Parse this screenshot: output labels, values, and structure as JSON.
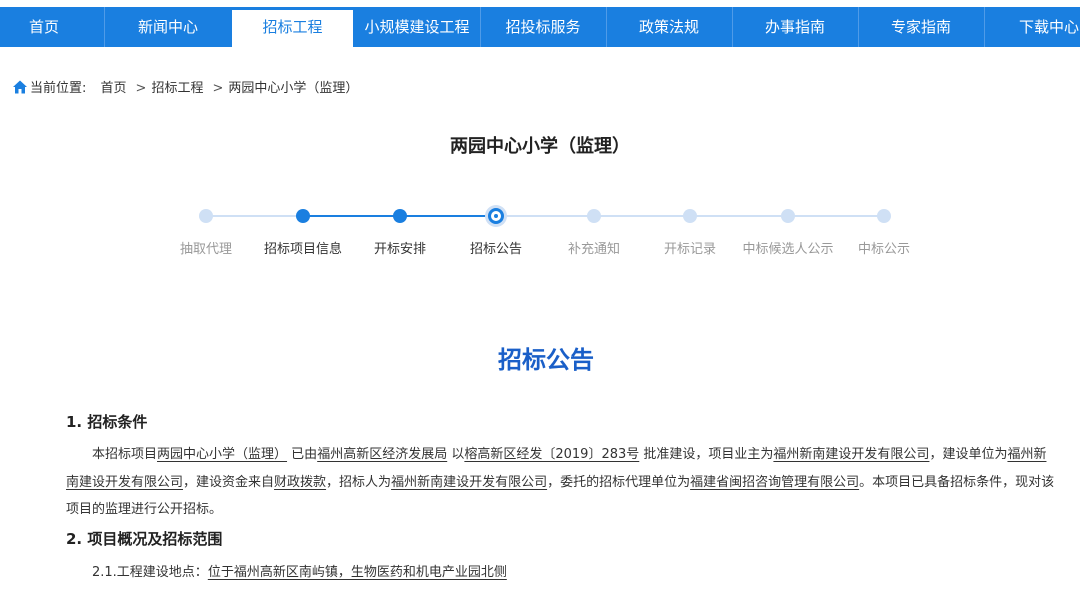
{
  "nav": {
    "items": [
      "首页",
      "新闻中心",
      "招标工程",
      "小规模建设工程",
      "招投标服务",
      "政策法规",
      "办事指南",
      "专家指南",
      "下载中心"
    ],
    "active": "招标工程"
  },
  "breadcrumb": {
    "label": "当前位置:",
    "items": [
      "首页",
      "招标工程",
      "两园中心小学（监理）"
    ]
  },
  "page_title": "两园中心小学（监理）",
  "steps": {
    "labels": [
      "抽取代理",
      "招标项目信息",
      "开标安排",
      "招标公告",
      "补充通知",
      "开标记录",
      "中标候选人公示",
      "中标公示"
    ],
    "completed": [
      1,
      2
    ],
    "current": 3
  },
  "notice_title": "招标公告",
  "section1": {
    "heading": "1. 招标条件",
    "t1": "本招标项目",
    "project": "两园中心小学（监理）",
    "t2": "已由",
    "approver": "福州高新区经济发展局",
    "t3": "以",
    "doc_no": "榕高新区经发〔2019〕283号",
    "t4": "批准建设，项目业主为",
    "owner": "福州新南建设开发有限公司",
    "t5": "，建设单位为",
    "builder": "福州新南建设开发有限公司",
    "t6": "，建设资金来自",
    "funding": "财政拨款",
    "t7": "，招标人为",
    "tenderer": "福州新南建设开发有限公司",
    "t8": "，委托的招标代理单位为",
    "agent": "福建省闽招咨询管理有限公司",
    "t9": "。本项目已具备招标条件，现对该项目的监理进行公开招标。"
  },
  "section2": {
    "heading": "2. 项目概况及招标范围",
    "location_label": "2.1.工程建设地点：",
    "location_value": "位于福州高新区南屿镇，生物医药和机电产业园北侧"
  },
  "colors": {
    "nav_bg": "#1a7fe0",
    "accent": "#1a5fc8",
    "step_done": "#1a7fe0",
    "step_pending": "#cfe0f5",
    "pending_text": "#999999"
  }
}
